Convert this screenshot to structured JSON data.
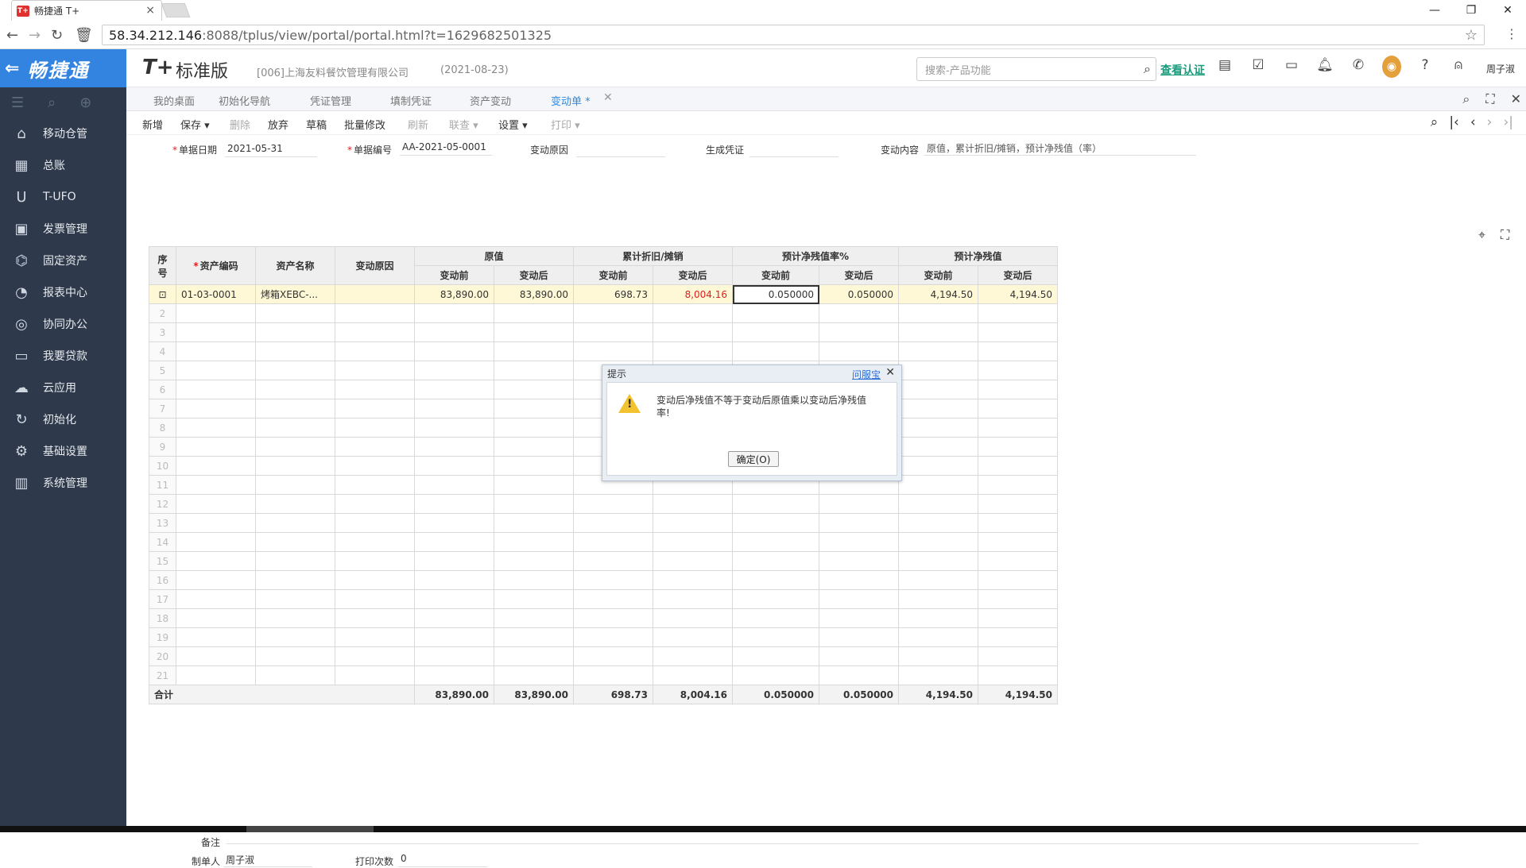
{
  "browser": {
    "tab_title": "畅捷通 T+",
    "favicon_text": "T+",
    "url_host": "58.34.212.146",
    "url_rest": ":8088/tplus/view/portal/portal.html?t=1629682501325"
  },
  "sidebar": {
    "brand": "畅捷通",
    "items": [
      {
        "label": "移动仓管",
        "icon": "mobile-warehouse-icon"
      },
      {
        "label": "总账",
        "icon": "ledger-icon"
      },
      {
        "label": "T-UFO",
        "icon": "ufo-icon"
      },
      {
        "label": "发票管理",
        "icon": "invoice-icon"
      },
      {
        "label": "固定资产",
        "icon": "bank-icon"
      },
      {
        "label": "报表中心",
        "icon": "pie-chart-icon"
      },
      {
        "label": "协同办公",
        "icon": "collab-icon"
      },
      {
        "label": "我要贷款",
        "icon": "money-icon"
      },
      {
        "label": "云应用",
        "icon": "cloud-icon"
      },
      {
        "label": "初始化",
        "icon": "refresh-icon"
      },
      {
        "label": "基础设置",
        "icon": "settings-icon"
      },
      {
        "label": "系统管理",
        "icon": "monitor-icon"
      }
    ]
  },
  "header": {
    "logo": "T+",
    "edition": "标准版",
    "company": "[006]上海友料餐饮管理有限公司",
    "date": "(2021-08-23)",
    "search_placeholder": "搜索-产品功能",
    "verify": "查看认证",
    "username": "周子淑"
  },
  "page_tabs": [
    "我的桌面",
    "初始化导航",
    "凭证管理",
    "填制凭证",
    "资产变动",
    "变动单 *"
  ],
  "toolbar": {
    "new": "新增",
    "save": "保存",
    "delete": "删除",
    "discard": "放弃",
    "draft": "草稿",
    "batch_edit": "批量修改",
    "refresh": "刷新",
    "link": "联查",
    "settings": "设置",
    "print": "打印"
  },
  "form": {
    "bill_date_label": "单据日期",
    "bill_date": "2021-05-31",
    "bill_no_label": "单据编号",
    "bill_no": "AA-2021-05-0001",
    "reason_label": "变动原因",
    "reason": "",
    "voucher_label": "生成凭证",
    "voucher": "",
    "content_label": "变动内容",
    "content": "原值，累计折旧/摊销，预计净残值（率）"
  },
  "table": {
    "headers": {
      "seq": "序号",
      "code": "资产编码",
      "name": "资产名称",
      "reason": "变动原因",
      "orig": "原值",
      "depr": "累计折旧/摊销",
      "rate": "预计净残值率%",
      "net": "预计净残值",
      "before": "变动前",
      "after": "变动后"
    },
    "row1": {
      "code": "01-03-0001",
      "name": "烤箱XEBC-...",
      "reason": "",
      "orig_before": "83,890.00",
      "orig_after": "83,890.00",
      "depr_before": "698.73",
      "depr_after": "8,004.16",
      "rate_before": "0.050000",
      "rate_after": "0.050000",
      "net_before": "4,194.50",
      "net_after": "4,194.50"
    },
    "empty_rows": [
      2,
      3,
      4,
      5,
      6,
      7,
      8,
      9,
      10,
      11,
      12,
      13,
      14,
      15,
      16,
      17,
      18,
      19,
      20,
      21
    ],
    "total": {
      "label": "合计",
      "orig_before": "83,890.00",
      "orig_after": "83,890.00",
      "depr_before": "698.73",
      "depr_after": "8,004.16",
      "rate_before": "0.050000",
      "rate_after": "0.050000",
      "net_before": "4,194.50",
      "net_after": "4,194.50"
    }
  },
  "footer": {
    "remark_label": "备注",
    "maker_label": "制单人",
    "maker": "周子淑",
    "print_count_label": "打印次数",
    "print_count": "0"
  },
  "dialog": {
    "title": "提示",
    "help": "问服宝",
    "message": "变动后净残值不等于变动后原值乘以变动后净残值率!",
    "ok": "确定(O)"
  }
}
